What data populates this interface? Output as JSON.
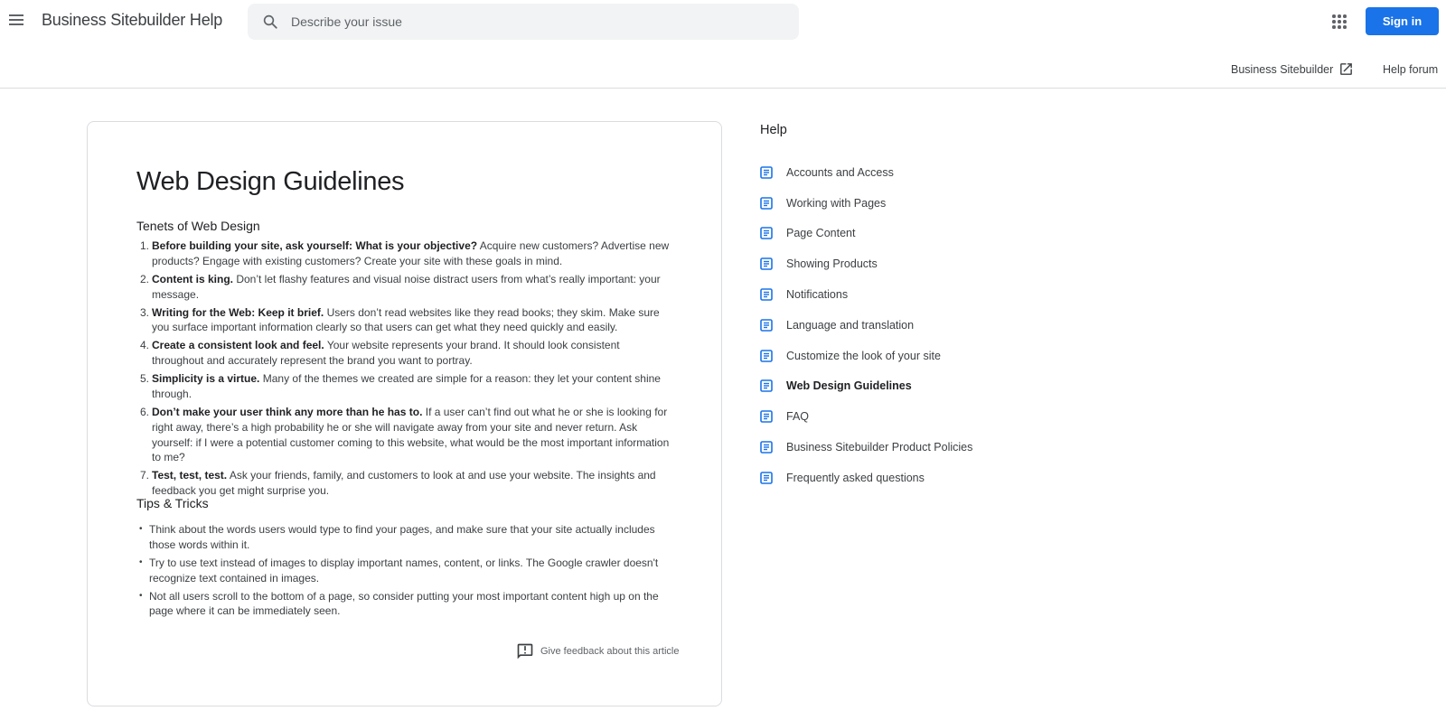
{
  "header": {
    "menu_icon": "hamburger-menu-icon",
    "app_title": "Business Sitebuilder Help",
    "search": {
      "icon": "search-icon",
      "placeholder": "Describe your issue",
      "value": ""
    },
    "apps_icon": "apps-grid-icon",
    "signin_label": "Sign in",
    "accent_color": "#1a73e8"
  },
  "subnav": {
    "product_link": "Business Sitebuilder",
    "product_link_icon": "open-in-new-icon",
    "forum_link": "Help forum"
  },
  "article": {
    "title": "Web Design Guidelines",
    "tenets_heading": "Tenets of Web Design",
    "tenets": [
      {
        "num": "1.",
        "bold": "Before building your site, ask yourself: What is your objective?",
        "text": " Acquire new customers? Advertise new products? Engage with existing customers? Create your site with these goals in mind."
      },
      {
        "num": "2.",
        "bold": "Content is king.",
        "text": " Don’t let flashy features and visual noise distract users from what’s really important: your message."
      },
      {
        "num": "3.",
        "bold": "Writing for the Web: Keep it brief.",
        "text": " Users don’t read websites like they read books; they skim. Make sure you surface important information clearly so that users can get what they need quickly and easily."
      },
      {
        "num": "4.",
        "bold": "Create a consistent look and feel.",
        "text": " Your website represents your brand. It should look consistent throughout and accurately represent the brand you want to portray."
      },
      {
        "num": "5.",
        "bold": "Simplicity is a virtue.",
        "text": " Many of the themes we created are simple for a reason: they let your content shine through."
      },
      {
        "num": "6.",
        "bold": "Don’t make your user think any more than he has to.",
        "text": " If a user can’t find out what he or she is looking for right away, there’s a high probability he or she will navigate away from your site and never return. Ask yourself: if I were a potential customer coming to this website, what would be the most important information to me?"
      },
      {
        "num": "7.",
        "bold": "Test, test, test.",
        "text": " Ask your friends, family, and customers to look at and use your website. The insights and feedback you get might surprise you."
      }
    ],
    "tips_heading": "Tips & Tricks",
    "tips": [
      "Think about the words users would type to find your pages, and make sure that your site actually includes those words within it.",
      "Try to use text instead of images to display important names, content, or links. The Google crawler doesn't recognize text contained in images.",
      "Not all users scroll to the bottom of a page, so consider putting your most important content high up on the page where it can be immediately seen."
    ],
    "tip_bullet": "•",
    "feedback_icon": "feedback-icon",
    "feedback_label": "Give feedback about this article"
  },
  "help": {
    "title": "Help",
    "item_icon": "article-icon",
    "icon_color": "#1a73e8",
    "items": [
      {
        "label": "Accounts and Access",
        "current": false
      },
      {
        "label": "Working with Pages",
        "current": false
      },
      {
        "label": "Page Content",
        "current": false
      },
      {
        "label": "Showing Products",
        "current": false
      },
      {
        "label": "Notifications",
        "current": false
      },
      {
        "label": "Language and translation",
        "current": false
      },
      {
        "label": "Customize the look of your site",
        "current": false
      },
      {
        "label": "Web Design Guidelines",
        "current": true
      },
      {
        "label": "FAQ",
        "current": false
      },
      {
        "label": "Business Sitebuilder Product Policies",
        "current": false
      },
      {
        "label": "Frequently asked questions",
        "current": false
      }
    ]
  }
}
